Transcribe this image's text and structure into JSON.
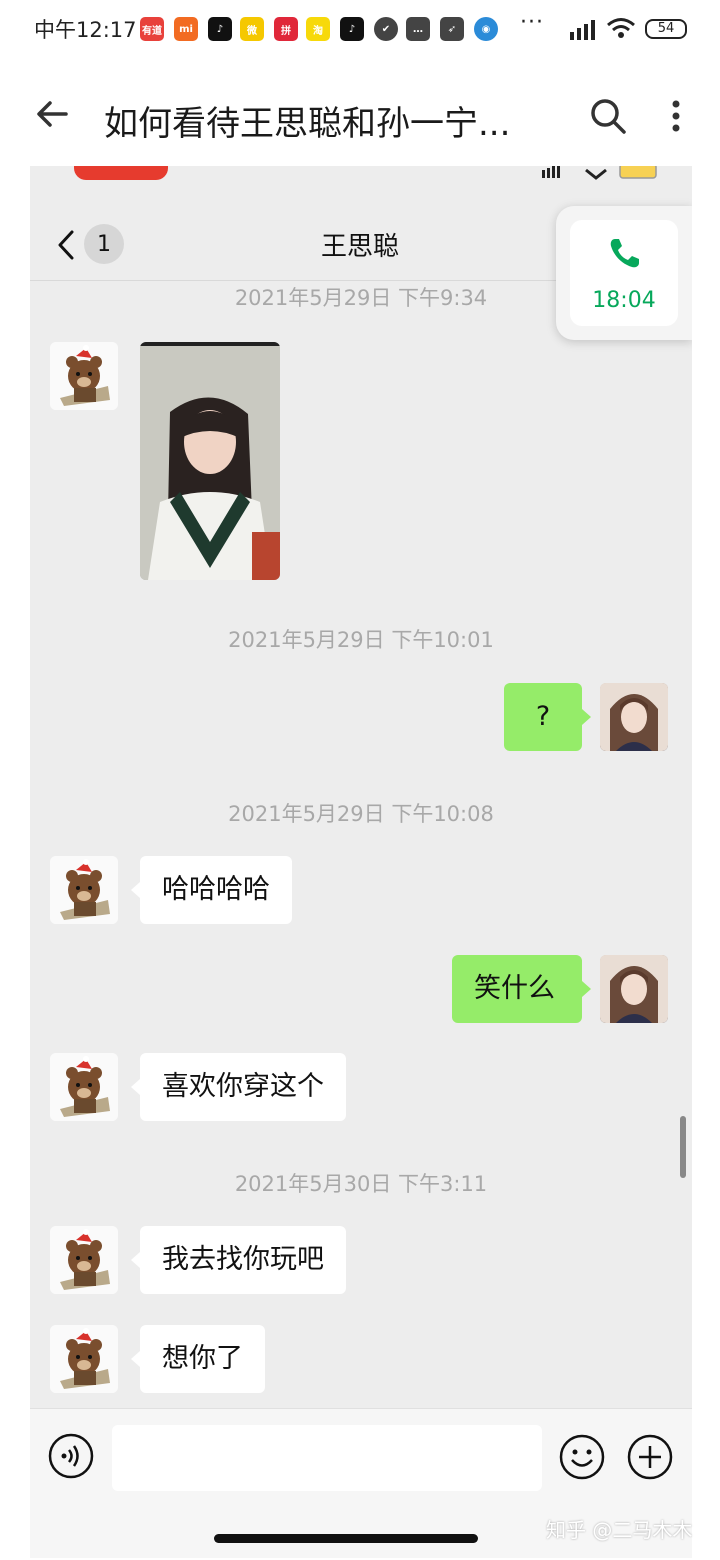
{
  "status_bar": {
    "time": "中午12:17",
    "battery": "54",
    "more": "···",
    "apps": [
      {
        "icon": "youdao-app-icon",
        "label": "有道",
        "color": "#e8413b"
      },
      {
        "icon": "mi-app-icon",
        "label": "mi",
        "color": "#f26b22"
      },
      {
        "icon": "douyin-app-icon",
        "label": "♪",
        "color": "#111111"
      },
      {
        "icon": "weibo-app-icon",
        "label": "微",
        "color": "#f5c800"
      },
      {
        "icon": "pinduoduo-app-icon",
        "label": "拼",
        "color": "#e0283a"
      },
      {
        "icon": "taobao-app-icon",
        "label": "淘",
        "color": "#f7d90a"
      },
      {
        "icon": "douyin-app-icon",
        "label": "♪",
        "color": "#111111"
      },
      {
        "icon": "check-app-icon",
        "label": "✔",
        "color": "#444444"
      },
      {
        "icon": "message-app-icon",
        "label": "…",
        "color": "#444444"
      },
      {
        "icon": "bird-app-icon",
        "label": "➶",
        "color": "#444444"
      },
      {
        "icon": "weather-app-icon",
        "label": "◉",
        "color": "#2b8bd8"
      }
    ]
  },
  "zhihu_header": {
    "title": "如何看待王思聪和孙一宁..."
  },
  "wechat": {
    "contact_name": "王思聪",
    "unread_badge": "1",
    "call_duration": "18:04",
    "timestamps": [
      "2021年5月29日 下午9:34",
      "2021年5月29日 下午10:01",
      "2021年5月29日 下午10:08",
      "2021年5月30日 下午3:11"
    ],
    "messages": [
      {
        "side": "left",
        "type": "image"
      },
      {
        "side": "right",
        "type": "text",
        "text": "?"
      },
      {
        "side": "left",
        "type": "text",
        "text": "哈哈哈哈"
      },
      {
        "side": "right",
        "type": "text",
        "text": "笑什么"
      },
      {
        "side": "left",
        "type": "text",
        "text": "喜欢你穿这个"
      },
      {
        "side": "left",
        "type": "text",
        "text": "我去找你玩吧"
      },
      {
        "side": "left",
        "type": "text",
        "text": "想你了"
      }
    ]
  },
  "watermark": "知乎 @二马木木",
  "colors": {
    "wechat_green_bubble": "#95ec69",
    "wechat_bg": "#ededed",
    "call_green": "#07a85b"
  }
}
